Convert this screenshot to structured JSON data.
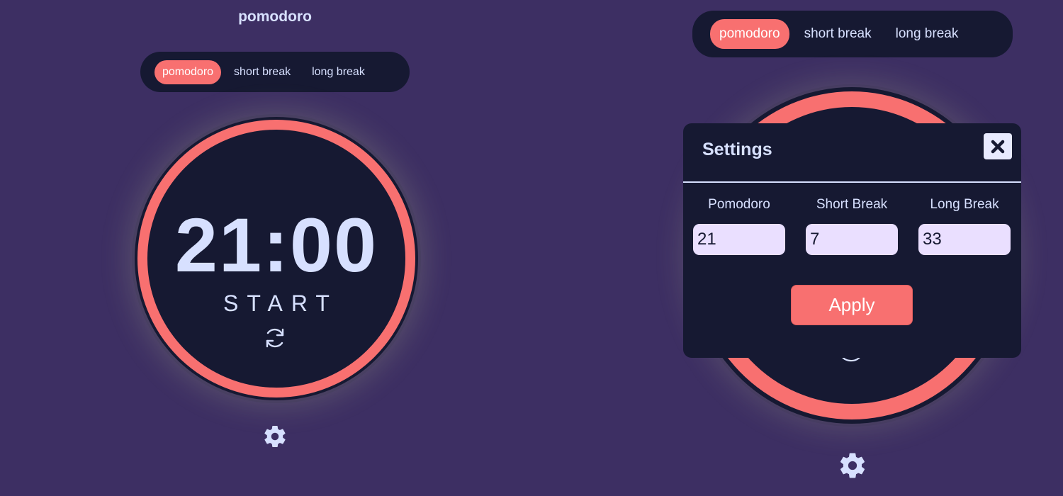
{
  "left_panel": {
    "title": "pomodoro",
    "tabs": [
      {
        "label": "pomodoro",
        "active": true
      },
      {
        "label": "short break",
        "active": false
      },
      {
        "label": "long break",
        "active": false
      }
    ],
    "timer": {
      "time": "21:00",
      "action": "START"
    },
    "icons": {
      "reset": "refresh-icon",
      "settings": "gear-icon"
    }
  },
  "right_panel": {
    "tabs": [
      {
        "label": "pomodoro",
        "active": true
      },
      {
        "label": "short break",
        "active": false
      },
      {
        "label": "long break",
        "active": false
      }
    ],
    "settings_modal": {
      "title": "Settings",
      "close_icon": "close-icon",
      "fields": [
        {
          "label": "Pomodoro",
          "value": "21"
        },
        {
          "label": "Short Break",
          "value": "7"
        },
        {
          "label": "Long Break",
          "value": "33"
        }
      ],
      "apply_label": "Apply"
    },
    "icons": {
      "settings": "gear-icon"
    }
  },
  "colors": {
    "background": "#3d2f63",
    "panel": "#161932",
    "accent": "#f87070",
    "text": "#d7e0ff",
    "input_bg": "#eadfff"
  }
}
